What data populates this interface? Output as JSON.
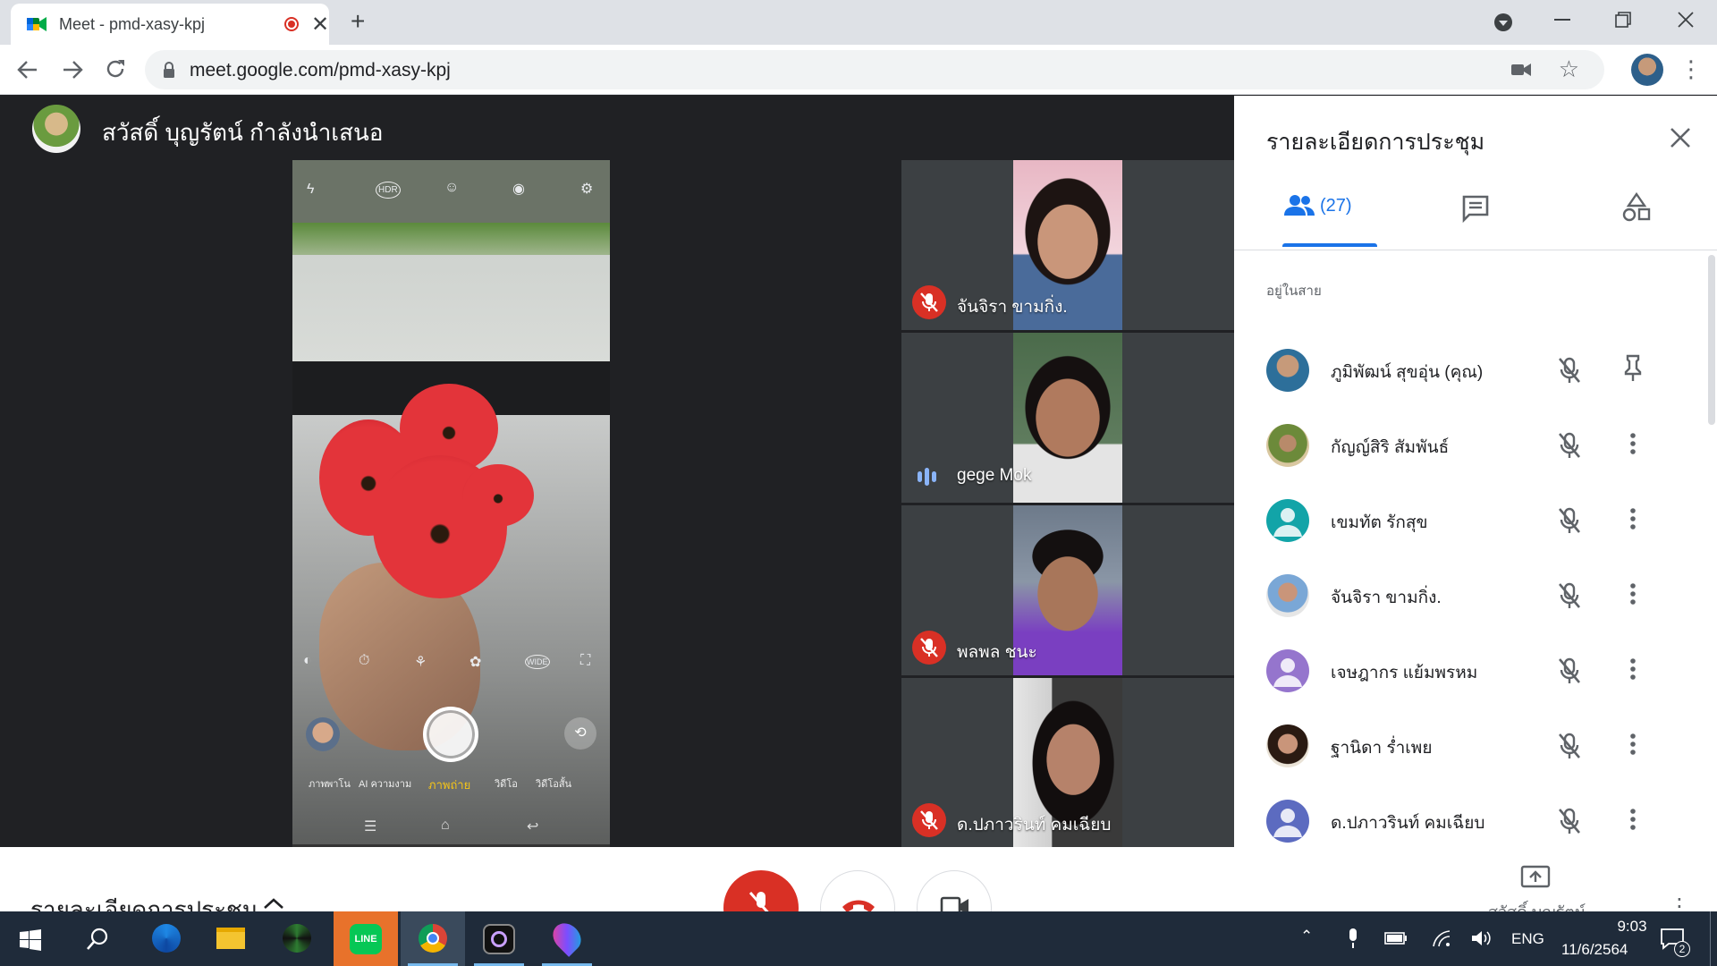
{
  "browser": {
    "tab_title": "Meet - pmd-xasy-kpj",
    "url": "meet.google.com/pmd-xasy-kpj",
    "new_tab_symbol": "+",
    "tab_close_symbol": "✕"
  },
  "meeting": {
    "presenter_caption": "สวัสดิ์ บุญรัตน์ กำลังนำเสนอ"
  },
  "camera_app": {
    "modes": [
      "ภาพ",
      "พาโน",
      "AI ความงาม",
      "ภาพถ่าย",
      "วิดีโอ",
      "วิดีโอสั้น"
    ],
    "active_mode_color": "#f5c518"
  },
  "tiles": [
    {
      "name": "จันจิรา ขามกิ่ง.",
      "state": "muted"
    },
    {
      "name": "gege Mok",
      "state": "speaking"
    },
    {
      "name": "พลพล ชนะ",
      "state": "muted"
    },
    {
      "name": "ด.ปภาวรินท์ คมเฉียบ",
      "state": "muted"
    }
  ],
  "panel": {
    "title": "รายละเอียดการประชุม",
    "people_count": "(27)",
    "in_call_label": "อยู่ในสาย",
    "participants": [
      {
        "name": "ภูมิพัฒน์ สุขอุ่น (คุณ)",
        "action": "pin-icon"
      },
      {
        "name": "กัญญ์สิริ สัมพันธ์",
        "action": "more-icon"
      },
      {
        "name": "เขมทัต รักสุข",
        "action": "more-icon"
      },
      {
        "name": "จันจิรา ขามกิ่ง.",
        "action": "more-icon"
      },
      {
        "name": "เจษฎากร แย้มพรหม",
        "action": "more-icon"
      },
      {
        "name": "ฐานิดา ร่ำเพย",
        "action": "more-icon"
      },
      {
        "name": "ด.ปภาวรินท์ คมเฉียบ",
        "action": "more-icon"
      }
    ]
  },
  "bottom_bar": {
    "details_label": "รายละเอียดการประชุม",
    "present_label": "สวัสดิ์ บุญรัตน์"
  },
  "taskbar": {
    "language": "ENG",
    "time": "9:03",
    "date": "11/6/2564",
    "notification_count": "2"
  },
  "colors": {
    "meet_dark": "#202124",
    "tile_bg": "#3c4043",
    "mute_red": "#d93025",
    "accent_blue": "#1a73e8",
    "speaking_blue": "#8ab4f8",
    "line_green": "#06c755"
  }
}
